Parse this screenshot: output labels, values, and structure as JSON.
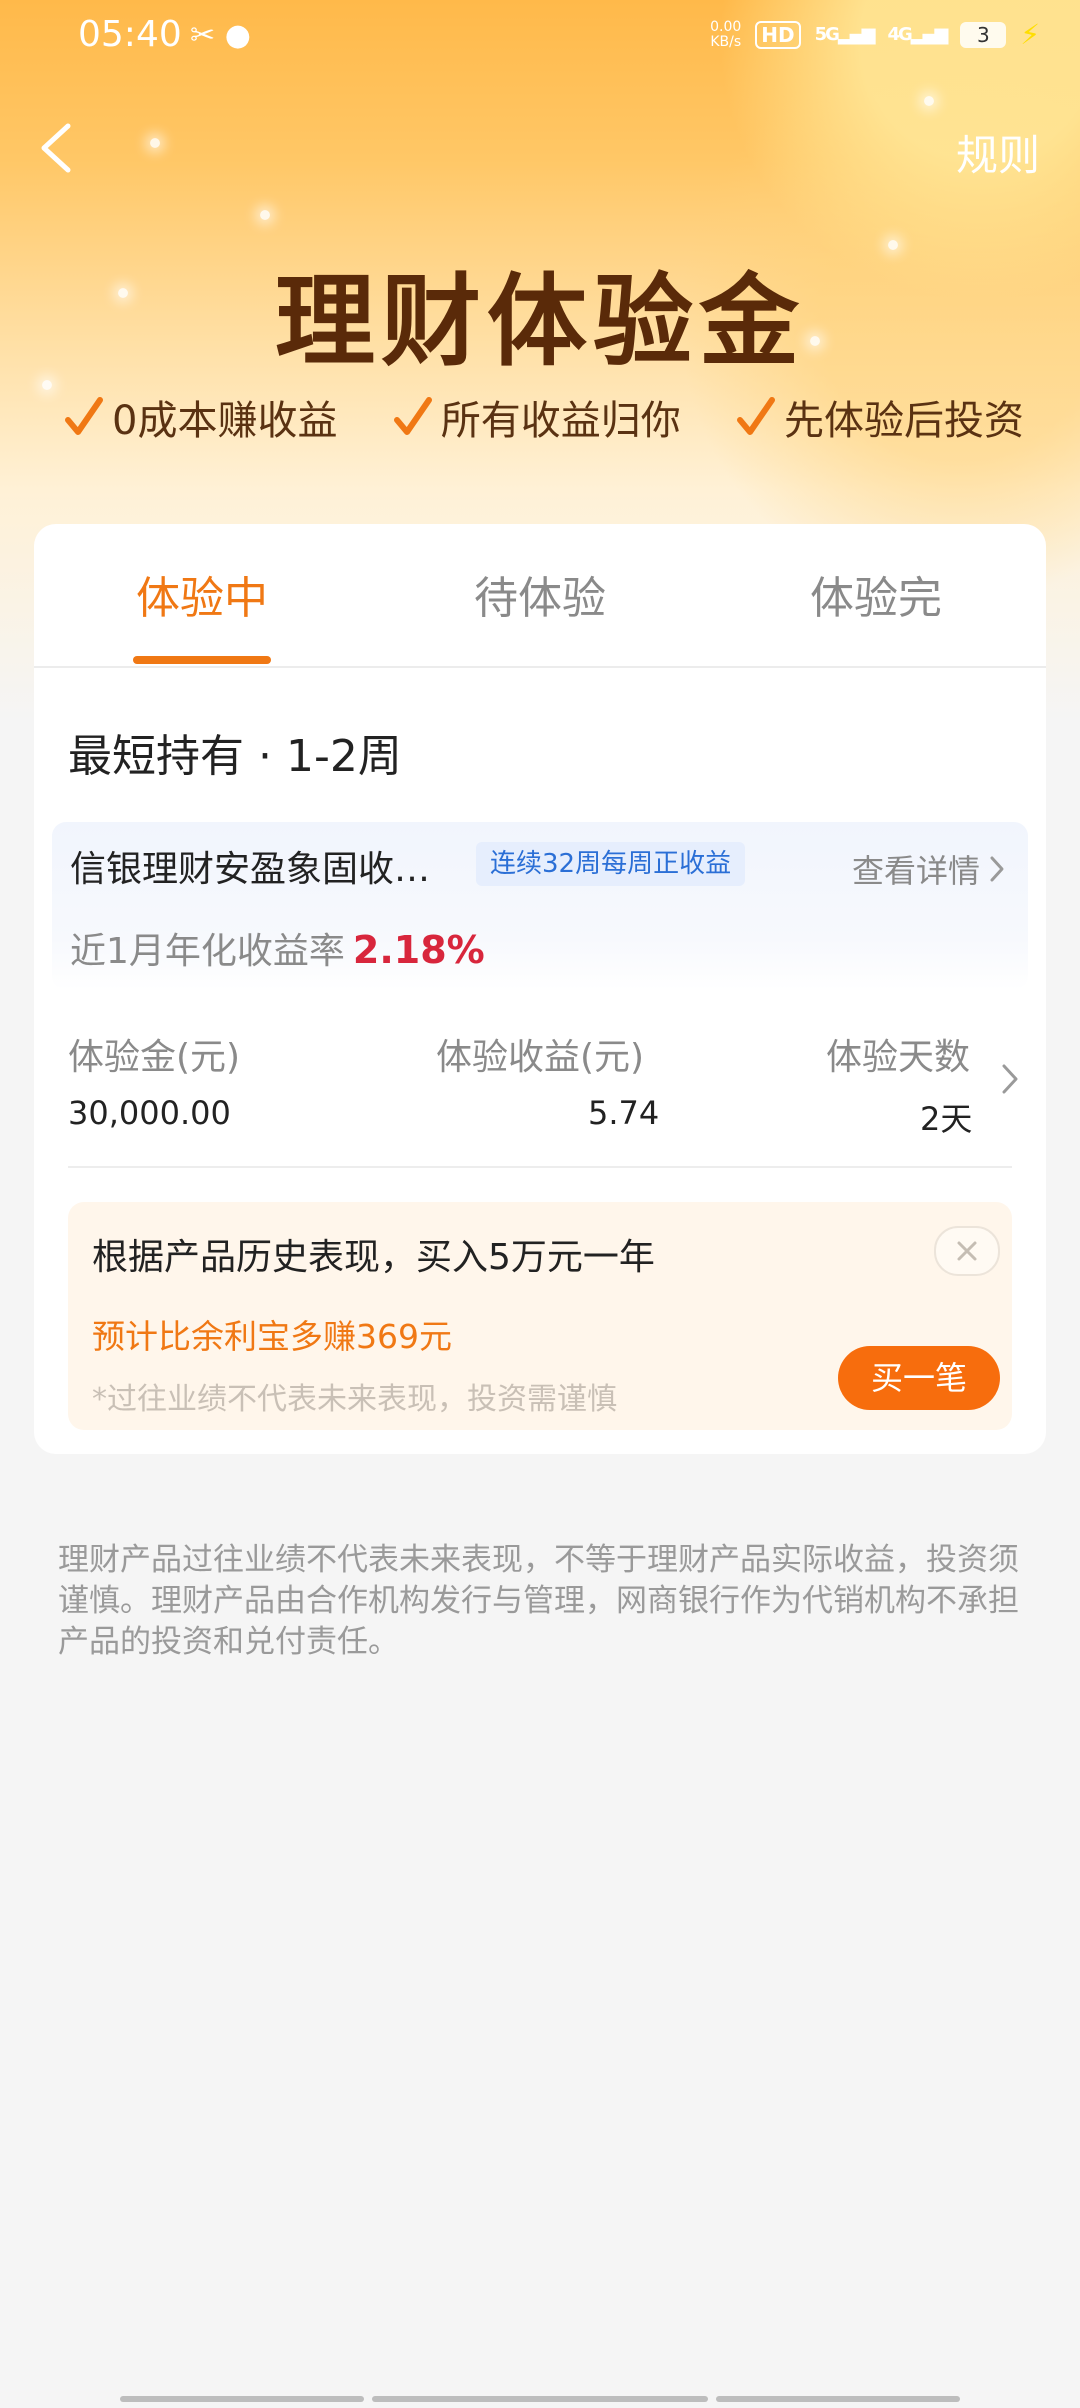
{
  "status_bar": {
    "time": "05:40",
    "net_speed_top": "0.00",
    "net_speed_unit": "KB/s",
    "hd_label": "HD",
    "sig1": "5G",
    "sig2": "4G",
    "battery": "3"
  },
  "nav": {
    "rules_label": "规则"
  },
  "hero": {
    "title": "理财体验金",
    "features": [
      "0成本赚收益",
      "所有收益归你",
      "先体验后投资"
    ]
  },
  "tabs": [
    {
      "label": "体验中",
      "active": true
    },
    {
      "label": "待体验",
      "active": false
    },
    {
      "label": "体验完",
      "active": false
    }
  ],
  "section": {
    "title": "最短持有 · 1-2周"
  },
  "product": {
    "name": "信银理财安盈象固收…",
    "badge": "连续32周每周正收益",
    "detail_link": "查看详情",
    "rate_label": "近1月年化收益率",
    "rate_value": "2.18%"
  },
  "stats": {
    "amount_label": "体验金(元)",
    "amount_value": "30,000.00",
    "earnings_label": "体验收益(元)",
    "earnings_value": "5.74",
    "days_label": "体验天数",
    "days_value": "2天"
  },
  "promo": {
    "main": "根据产品历史表现，买入5万元一年",
    "sub": "预计比余利宝多赚369元",
    "note": "*过往业绩不代表未来表现，投资需谨慎",
    "button": "买一笔"
  },
  "disclaimer": "理财产品过往业绩不代表未来表现，不等于理财产品实际收益，投资须谨慎。理财产品由合作机构发行与管理，网商银行作为代销机构不承担产品的投资和兑付责任。",
  "colors": {
    "accent": "#f07814",
    "rate": "#d8263c",
    "badge_text": "#2b6fd6",
    "title": "#5a2a09"
  }
}
